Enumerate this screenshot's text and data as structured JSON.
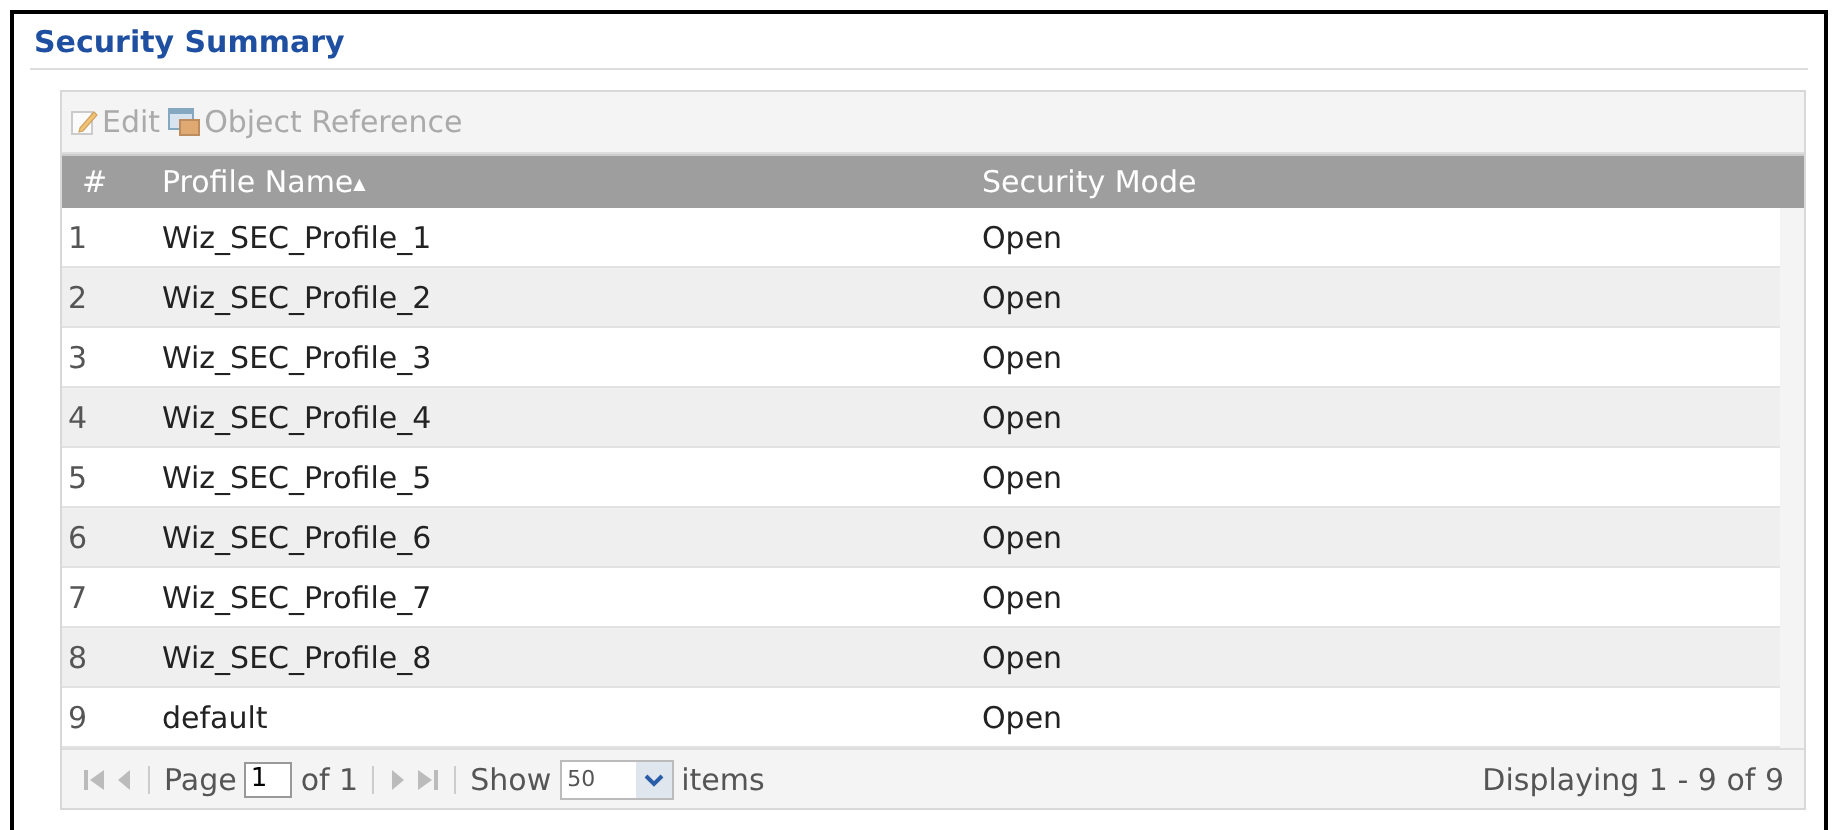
{
  "panel": {
    "title": "Security Summary"
  },
  "toolbar": [
    {
      "label": "Edit",
      "kind": "edit",
      "disabled": true
    },
    {
      "label": "Object Reference",
      "kind": "reference",
      "disabled": true
    }
  ],
  "table": {
    "columns": [
      {
        "label": "#"
      },
      {
        "label": "Profile Name",
        "sort": "▲"
      },
      {
        "label": "Security Mode"
      }
    ],
    "rows": [
      {
        "cells": [
          "1",
          "Wiz_SEC_Profile_1",
          "Open"
        ]
      },
      {
        "cells": [
          "2",
          "Wiz_SEC_Profile_2",
          "Open"
        ]
      },
      {
        "cells": [
          "3",
          "Wiz_SEC_Profile_3",
          "Open"
        ]
      },
      {
        "cells": [
          "4",
          "Wiz_SEC_Profile_4",
          "Open"
        ]
      },
      {
        "cells": [
          "5",
          "Wiz_SEC_Profile_5",
          "Open"
        ]
      },
      {
        "cells": [
          "6",
          "Wiz_SEC_Profile_6",
          "Open"
        ]
      },
      {
        "cells": [
          "7",
          "Wiz_SEC_Profile_7",
          "Open"
        ]
      },
      {
        "cells": [
          "8",
          "Wiz_SEC_Profile_8",
          "Open"
        ]
      },
      {
        "cells": [
          "9",
          "default",
          "Open"
        ]
      }
    ]
  },
  "pager": {
    "page_label": "Page",
    "page": "1",
    "of": "of 1",
    "show": "Show",
    "per_page": "50",
    "items": "items",
    "status": "Displaying 1 - 9 of 9"
  }
}
